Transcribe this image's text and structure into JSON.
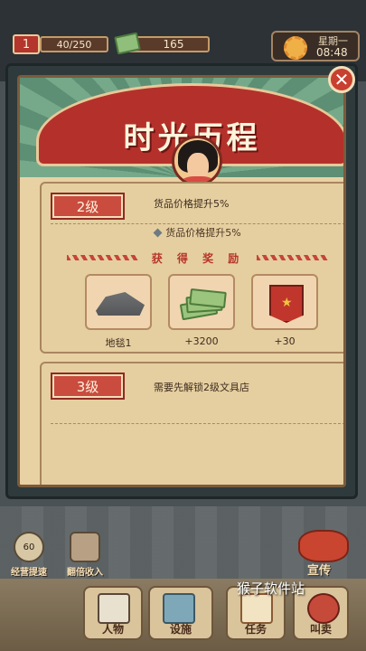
{
  "hud": {
    "level": "1",
    "exp": "40/250",
    "cash": "165",
    "weekday": "星期一",
    "time": "08:48"
  },
  "modal": {
    "title": "时光历程",
    "close_label": "✕",
    "levels": [
      {
        "badge": "2级",
        "description": "货品价格提升5%",
        "effect": "货品价格提升5%",
        "reward_title": "获 得 奖 励",
        "rewards": [
          {
            "label": "地毯1",
            "icon": "carpet-icon"
          },
          {
            "label": "+3200",
            "icon": "cash-icon"
          },
          {
            "label": "+30",
            "icon": "banner-flag-icon"
          }
        ]
      },
      {
        "badge": "3级",
        "description": "需要先解锁2级文具店"
      }
    ]
  },
  "bottom": {
    "speedup_timer": "60",
    "speedup_label": "经营提速",
    "double_income_label": "翻倍收入",
    "promo_label": "宣传",
    "tabs": {
      "people": "人物",
      "facility": "设施",
      "task": "任务",
      "sell": "叫卖"
    },
    "watermark": "猴子软件站"
  },
  "colors": {
    "banner_red": "#b4312b",
    "parchment": "#e8d2a4",
    "sunburst_green": "#5d8f74"
  }
}
